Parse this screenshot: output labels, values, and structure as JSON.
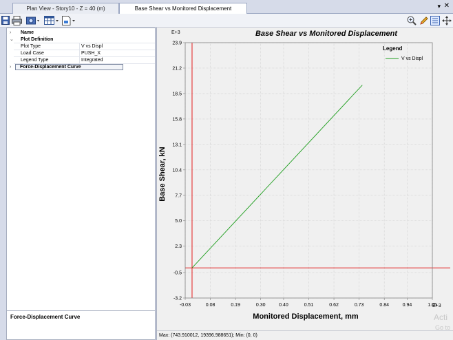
{
  "tabs": [
    {
      "label": "Plan View - Story10 - Z = 40 (m)"
    },
    {
      "label": "Base Shear vs Monitored Displacement"
    }
  ],
  "window_controls": {
    "dropdown": "▾",
    "close": "✕"
  },
  "property_panel": {
    "root": {
      "label": "Name"
    },
    "group": {
      "label": "Plot Definition"
    },
    "rows": [
      {
        "key": "Plot Type",
        "value": "V vs Displ"
      },
      {
        "key": "Load Case",
        "value": "PUSH_X"
      },
      {
        "key": "Legend Type",
        "value": "Integrated"
      }
    ],
    "group2": {
      "label": "Force-Displacement Curve"
    },
    "description": "Force-Displacement Curve"
  },
  "status": {
    "text": "Max: (743.910012, 19396.988651);  Min: (0, 0)"
  },
  "watermark": {
    "line1": "Acti",
    "line2": "Go to"
  },
  "chart_data": {
    "type": "line",
    "title": "Base Shear vs Monitored Displacement",
    "xlabel": "Monitored Displacement, mm",
    "ylabel": "Base Shear, kN",
    "x_scale_label": "E+3",
    "y_scale_label": "E+3",
    "xlim": [
      -0.03,
      1.05
    ],
    "ylim": [
      -3.2,
      23.9
    ],
    "x_ticks": [
      -0.03,
      0.08,
      0.19,
      0.3,
      0.4,
      0.51,
      0.62,
      0.73,
      0.84,
      0.94,
      1.05
    ],
    "x_tick_labels": [
      "-0.03",
      "0.08",
      "0.19",
      "0.30",
      "0.40",
      "0.51",
      "0.62",
      "0.73",
      "0.84",
      "0.94",
      "1.05"
    ],
    "y_ticks": [
      23.9,
      21.2,
      18.5,
      15.8,
      13.1,
      10.4,
      7.7,
      5.0,
      2.3,
      -0.5,
      -3.2
    ],
    "y_tick_labels": [
      "23.9",
      "21.2",
      "18.5",
      "15.8",
      "13.1",
      "10.4",
      "7.7",
      "5.0",
      "2.3",
      "-0.5",
      "-3.2"
    ],
    "legend": {
      "title": "Legend",
      "placement": "top-right"
    },
    "grid": true,
    "axes_lines_color": "#e00000",
    "series": [
      {
        "name": "V vs Displ",
        "color": "#1e9e1e",
        "x": [
          0.0,
          0.74391
        ],
        "y": [
          0.0,
          19.397
        ]
      }
    ]
  },
  "colors": {
    "chrome": "#d6dbe9",
    "plot_bg": "#f0f0f0",
    "series": "#1e9e1e",
    "zero_lines": "#e00000"
  },
  "icons": [
    "save-icon",
    "print-icon",
    "camera-icon",
    "table-icon",
    "export-icon",
    "zoom-icon",
    "pencil-icon",
    "properties-icon",
    "pan-icon"
  ]
}
